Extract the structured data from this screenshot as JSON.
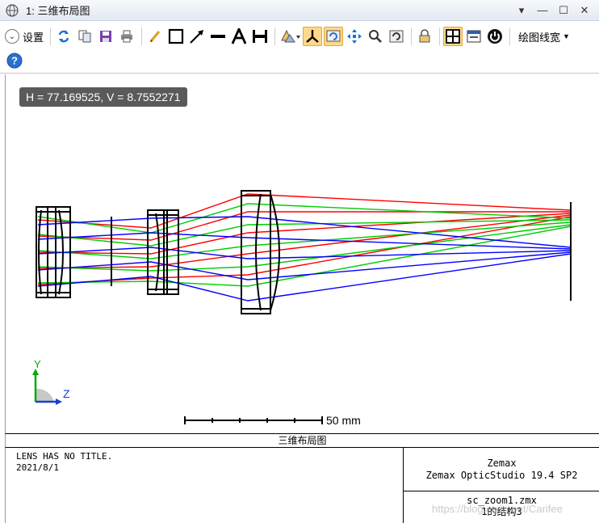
{
  "window": {
    "title": "1: 三维布局图"
  },
  "toolbar": {
    "settings_label": "设置",
    "linewidth_label": "绘图线宽",
    "icons": [
      "refresh-icon",
      "copy-icon",
      "save-icon",
      "print-icon",
      "pencil-icon",
      "rectangle-icon",
      "arrow-icon",
      "line-icon",
      "text-icon",
      "dimension-icon",
      "rotate-icon",
      "axis-icon",
      "fit-icon",
      "pan-icon",
      "zoom-icon",
      "reset-icon",
      "lock-icon",
      "grid-icon",
      "window-icon",
      "power-icon",
      "help-icon"
    ]
  },
  "coord_readout": "H = 77.169525, V = 8.7552271",
  "axis_labels": {
    "y": "Y",
    "z": "Z"
  },
  "scale_bar": {
    "label": "50 mm"
  },
  "caption": "三维布局图",
  "info": {
    "line1": "LENS HAS NO TITLE.",
    "line2": "2021/8/1",
    "company": "Zemax",
    "software": "Zemax OpticStudio 19.4 SP2",
    "file": "sc_zoom1.zmx",
    "config": "1的结构3"
  },
  "watermark": "https://blog.csdn.net/Carifee",
  "colors": {
    "ray_field1": "#ff0000",
    "ray_field2": "#00cc00",
    "ray_field3": "#0000ff",
    "lens": "#000000",
    "highlight": "#ffd889"
  }
}
